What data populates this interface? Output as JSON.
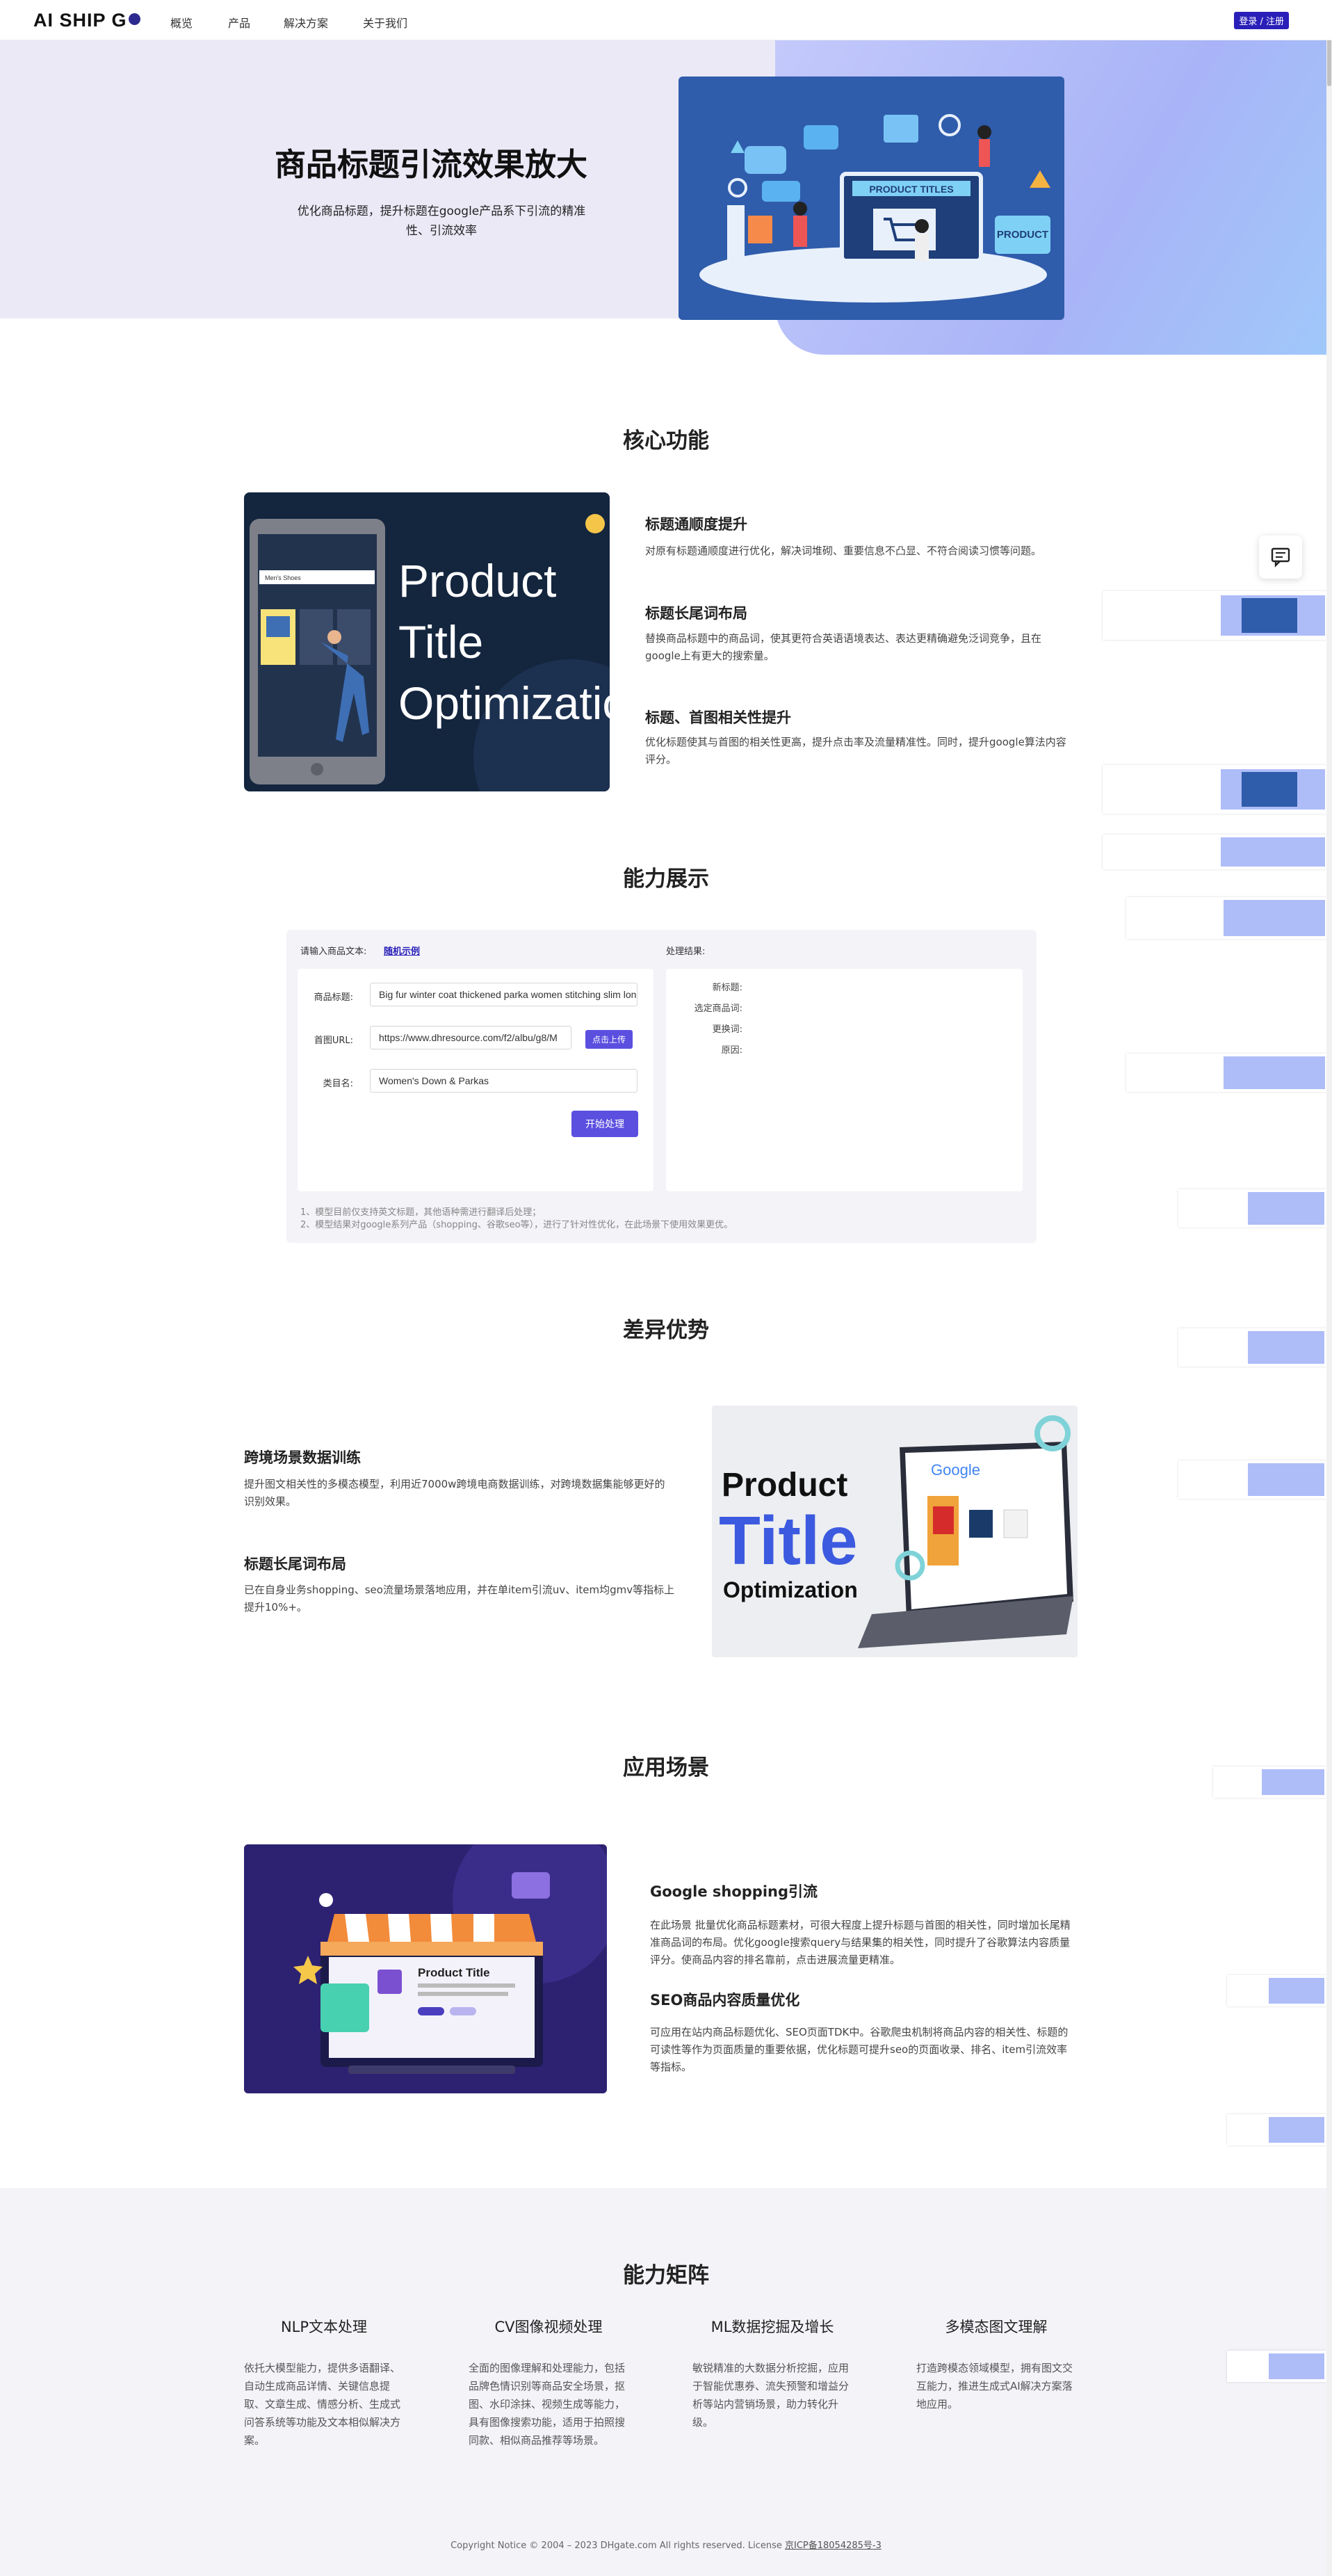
{
  "nav": {
    "logo": "AI SHIP G",
    "items": [
      "概览",
      "产品",
      "解决方案",
      "关于我们"
    ],
    "login": "登录 / 注册"
  },
  "hero": {
    "title": "商品标题引流效果放大",
    "subtitle": "优化商品标题，提升标题在google产品系下引流的精准性、引流效率",
    "image_words": [
      "PRODUCT TITLES",
      "PRODUCT"
    ]
  },
  "core": {
    "title": "核心功能",
    "image_text": [
      "Product",
      "Title",
      "Optimization"
    ],
    "image_small": "Men's Shoes",
    "features": [
      {
        "title": "标题通顺度提升",
        "desc": "对原有标题通顺度进行优化，解决词堆砌、重要信息不凸显、不符合阅读习惯等问题。"
      },
      {
        "title": "标题长尾词布局",
        "desc": "替换商品标题中的商品词，使其更符合英语语境表达、表达更精确避免泛词竞争，且在google上有更大的搜索量。"
      },
      {
        "title": "标题、首图相关性提升",
        "desc": "优化标题使其与首图的相关性更高，提升点击率及流量精准性。同时，提升google算法内容评分。"
      }
    ]
  },
  "demo": {
    "title": "能力展示",
    "input_label": "请输入商品文本:",
    "random_link": "随机示例",
    "fields": [
      {
        "label": "商品标题:",
        "value": "Big fur winter coat thickened parka women stitching slim long winter coat"
      },
      {
        "label": "首图URL:",
        "value": "https://www.dhresource.com/f2/albu/g8/M"
      },
      {
        "label": "类目名:",
        "value": "Women's Down & Parkas"
      }
    ],
    "upload": "点击上传",
    "process": "开始处理",
    "result_label": "处理结果:",
    "results": [
      "新标题:",
      "选定商品词:",
      "更换词:",
      "原因:"
    ],
    "notes": [
      "1、模型目前仅支持英文标题，其他语种需进行翻译后处理；",
      "2、模型结果对google系列产品（shopping、谷歌seo等），进行了针对性优化，在此场景下使用效果更优。"
    ]
  },
  "advantage": {
    "title": "差异优势",
    "features": [
      {
        "title": "跨境场景数据训练",
        "desc": "提升图文相关性的多模态模型，利用近7000w跨境电商数据训练，对跨境数据集能够更好的识别效果。"
      },
      {
        "title": "标题长尾词布局",
        "desc": "已在自身业务shopping、seo流量场景落地应用，并在单item引流uv、item均gmv等指标上 提升10%+。"
      }
    ],
    "image_text": [
      "Product",
      "Title",
      "Optimization"
    ],
    "image_brand": "Google"
  },
  "scene": {
    "title": "应用场景",
    "image_text": "Product Title",
    "features": [
      {
        "title": "Google shopping引流",
        "desc": "在此场景 批量优化商品标题素材，可很大程度上提升标题与首图的相关性，同时增加长尾精准商品词的布局。优化google搜索query与结果集的相关性，同时提升了谷歌算法内容质量评分。使商品内容的排名靠前，点击进展流量更精准。"
      },
      {
        "title": "SEO商品内容质量优化",
        "desc": "可应用在站内商品标题优化、SEO页面TDK中。谷歌爬虫机制将商品内容的相关性、标题的可读性等作为页面质量的重要依据，优化标题可提升seo的页面收录、排名、item引流效率等指标。"
      }
    ]
  },
  "matrix": {
    "title": "能力矩阵",
    "items": [
      {
        "title": "NLP文本处理",
        "desc": "依托大模型能力，提供多语翻译、自动生成商品详情、关键信息提取、文章生成、情感分析、生成式问答系统等功能及文本相似解决方案。"
      },
      {
        "title": "CV图像视频处理",
        "desc": "全面的图像理解和处理能力，包括品牌色情识别等商品安全场景，抠图、水印涂抹、视频生成等能力，具有图像搜索功能，适用于拍照搜同款、相似商品推荐等场景。"
      },
      {
        "title": "ML数据挖掘及增长",
        "desc": "敏锐精准的大数据分析挖掘，应用于智能优惠券、流失预警和增益分析等站内营销场景，助力转化升级。"
      },
      {
        "title": "多模态图文理解",
        "desc": "打造跨模态领域模型，拥有图文交互能力，推进生成式AI解决方案落地应用。"
      }
    ]
  },
  "footer": {
    "text": "Copyright Notice © 2004 – 2023 DHgate.com All rights reserved. License ",
    "icp": "京ICP备18054285号-3"
  },
  "colors": {
    "accent": "#2a1fb8",
    "button": "#5b4fe0",
    "hero_bg": "#ece9f7"
  }
}
